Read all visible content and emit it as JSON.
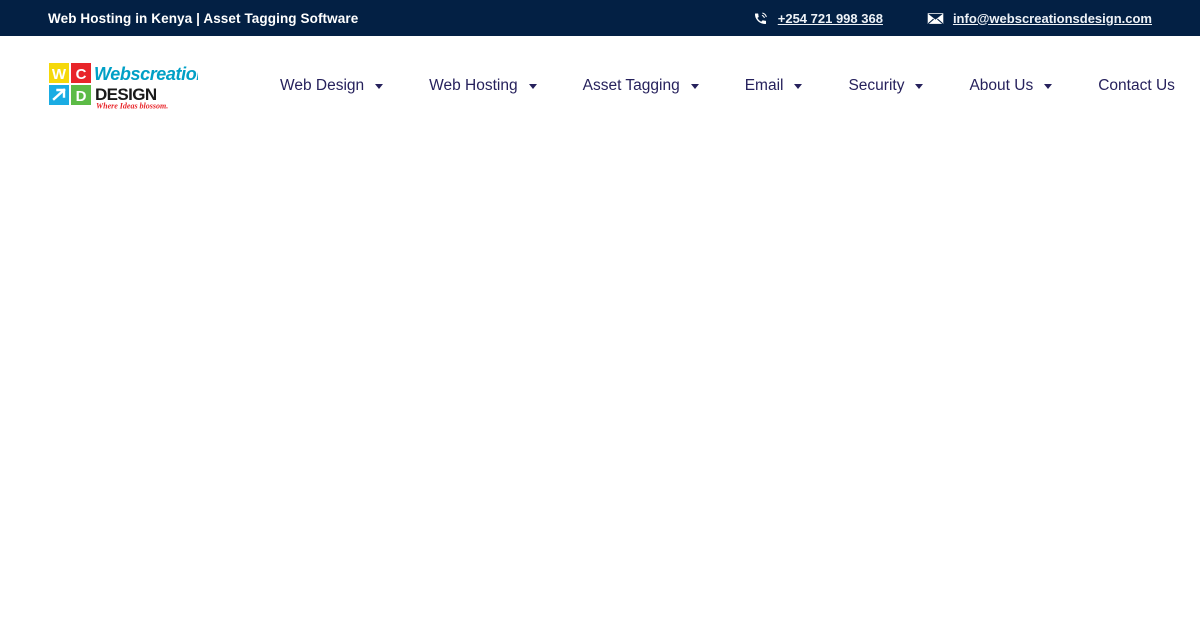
{
  "topbar": {
    "title": "Web Hosting in Kenya | Asset Tagging Software",
    "phone": "+254 721 998 368",
    "email": "info@webscreationsdesign.com",
    "phone_icon": "phone-ringing-icon",
    "email_icon": "envelope-icon",
    "background_color": "#032044",
    "text_color": "#ffffff"
  },
  "logo": {
    "brand_top": "Webscreations",
    "brand_bottom": "DESIGN",
    "tagline": "Where Ideas blossom.",
    "tiles": [
      {
        "letter": "W",
        "color": "#f5d80a"
      },
      {
        "letter": "C",
        "color": "#e8252a"
      },
      {
        "letter": "↗",
        "color": "#1aace3"
      },
      {
        "letter": "D",
        "color": "#5cbb46"
      }
    ],
    "brand_top_color": "#00a0c6",
    "brand_bottom_color": "#1a1a1a",
    "tagline_color": "#e8252a"
  },
  "nav": {
    "accent_color": "#26215c",
    "items": [
      {
        "label": "Web Design",
        "has_dropdown": true
      },
      {
        "label": "Web Hosting",
        "has_dropdown": true
      },
      {
        "label": "Asset Tagging",
        "has_dropdown": true
      },
      {
        "label": "Email",
        "has_dropdown": true
      },
      {
        "label": "Security",
        "has_dropdown": true
      },
      {
        "label": "About Us",
        "has_dropdown": true
      },
      {
        "label": "Contact Us",
        "has_dropdown": false
      }
    ]
  }
}
